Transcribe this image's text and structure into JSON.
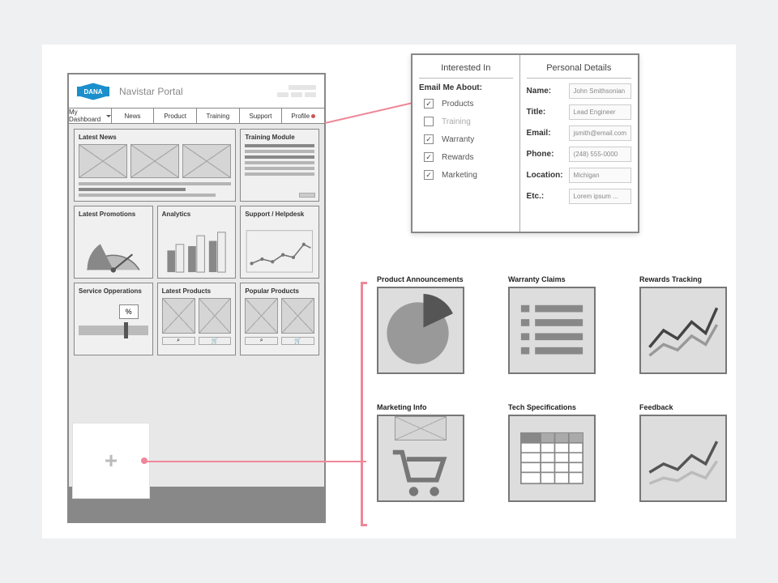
{
  "portal": {
    "title": "Navistar Portal",
    "logo": "DANA"
  },
  "nav": {
    "dash": "My Dashboard",
    "news": "News",
    "product": "Product",
    "training": "Training",
    "support": "Support",
    "profile": "Profile"
  },
  "cards": {
    "news": "Latest News",
    "training": "Training Module",
    "promo": "Latest Promotions",
    "analytics": "Analytics",
    "support": "Support / Helpdesk",
    "service": "Service Opperations",
    "latestProd": "Latest Products",
    "popular": "Popular Products",
    "pct": "%"
  },
  "callout": {
    "interested": "Interested In",
    "emailAbout": "Email Me About:",
    "opts": {
      "products": "Products",
      "training": "Training",
      "warranty": "Warranty",
      "rewards": "Rewards",
      "marketing": "Marketing"
    },
    "personal": "Personal Details",
    "name": {
      "l": "Name:",
      "v": "John Smithsonian"
    },
    "title": {
      "l": "Title:",
      "v": "Lead Engineer"
    },
    "email": {
      "l": "Email:",
      "v": "jsmith@email.com"
    },
    "phone": {
      "l": "Phone:",
      "v": "(248) 555-0000"
    },
    "location": {
      "l": "Location:",
      "v": "Michigan"
    },
    "etc": {
      "l": "Etc.:",
      "v": "Lorem ipsum ..."
    }
  },
  "widgets": {
    "pa": "Product Announcements",
    "wc": "Warranty Claims",
    "rt": "Rewards Tracking",
    "mi": "Marketing Info",
    "ts": "Tech Specifications",
    "fb": "Feedback"
  }
}
